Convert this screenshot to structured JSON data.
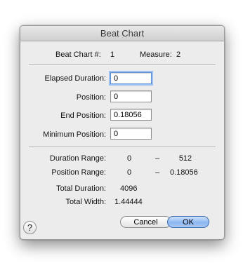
{
  "window": {
    "title": "Beat Chart"
  },
  "header": {
    "beat_chart_label": "Beat Chart #:",
    "beat_chart_value": "1",
    "measure_label": "Measure:",
    "measure_value": "2"
  },
  "fields": {
    "elapsed_duration": {
      "label": "Elapsed Duration:",
      "value": "0"
    },
    "position": {
      "label": "Position:",
      "value": "0"
    },
    "end_position": {
      "label": "End Position:",
      "value": "0.18056"
    },
    "minimum_position": {
      "label": "Minimum Position:",
      "value": "0"
    }
  },
  "info": {
    "duration_range": {
      "label": "Duration Range:",
      "min": "0",
      "dash": "–",
      "max": "512"
    },
    "position_range": {
      "label": "Position Range:",
      "min": "0",
      "dash": "–",
      "max": "0.18056"
    },
    "total_duration": {
      "label": "Total Duration:",
      "value": "4096"
    },
    "total_width": {
      "label": "Total Width:",
      "value": "1.44444"
    }
  },
  "buttons": {
    "help": "?",
    "cancel": "Cancel",
    "ok": "OK"
  },
  "colors": {
    "focus_ring": "#9cc0f0",
    "default_button": "#8db7f0"
  }
}
